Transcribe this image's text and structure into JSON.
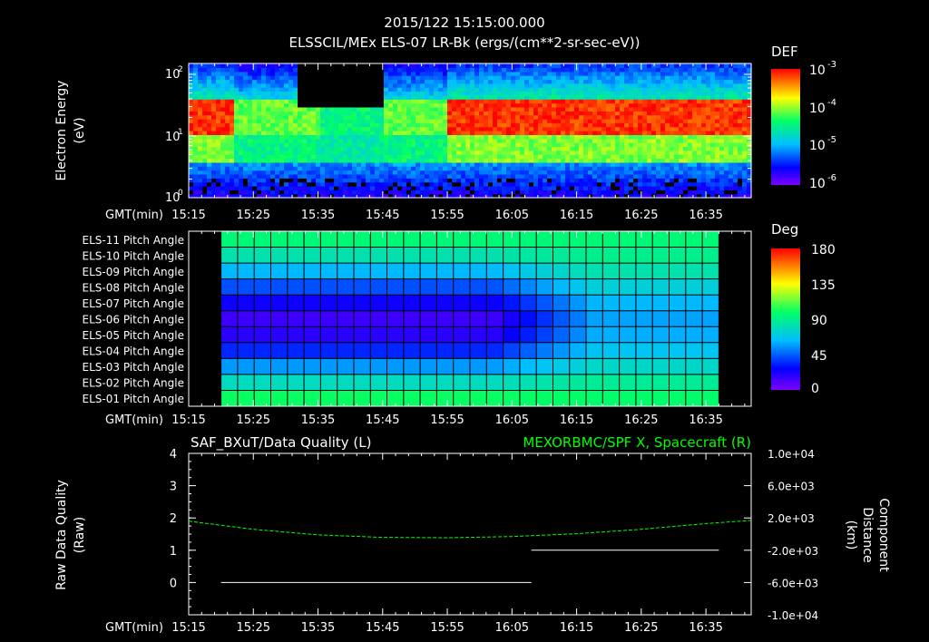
{
  "header": {
    "timestamp": "2015/122 15:15:00.000",
    "title": "ELSSCIL/MEx ELS-07 LR-Bk   (ergs/(cm**2-sr-sec-eV))"
  },
  "time_axis": {
    "label": "GMT(min)",
    "ticks": [
      "15:15",
      "15:25",
      "15:35",
      "15:45",
      "15:55",
      "16:05",
      "16:15",
      "16:25",
      "16:35"
    ]
  },
  "colors": {
    "background": "#000000",
    "axes": "#ffffff",
    "component_trace": "#00ff00",
    "quality_trace": "#ffffff"
  },
  "chart_data": [
    {
      "type": "heatmap",
      "title": "ELSSCIL/MEx ELS-07 LR-Bk   (ergs/(cm**2-sr-sec-eV))",
      "ylabel_line1": "Electron Energy",
      "ylabel_line2": "(eV)",
      "y_scale": "log",
      "ylim": [
        1,
        150
      ],
      "y_ticks": [
        {
          "base": "10",
          "exp": "2"
        },
        {
          "base": "10",
          "exp": "1"
        },
        {
          "base": "10",
          "exp": "0"
        }
      ],
      "colorbar": {
        "label": "DEF",
        "scale": "log",
        "ticks": [
          {
            "base": "10",
            "exp": "-3"
          },
          {
            "base": "10",
            "exp": "-4"
          },
          {
            "base": "10",
            "exp": "-5"
          },
          {
            "base": "10",
            "exp": "-6"
          }
        ]
      },
      "time_start": "15:15",
      "time_end": "16:42",
      "features": [
        {
          "desc": "intense band 10-40 eV",
          "time_range": [
            "15:15",
            "15:22"
          ]
        },
        {
          "desc": "depleted region (data gap) above 30 eV",
          "time_range": [
            "15:35",
            "15:45"
          ]
        },
        {
          "desc": "intense band 10-40 eV",
          "time_range": [
            "15:55",
            "16:42"
          ]
        }
      ]
    },
    {
      "type": "heatmap",
      "colorbar": {
        "label": "Deg",
        "ticks": [
          "180",
          "135",
          "90",
          "45",
          "0"
        ],
        "range": [
          0,
          180
        ]
      },
      "rows": [
        "ELS-11 Pitch Angle",
        "ELS-10 Pitch Angle",
        "ELS-09 Pitch Angle",
        "ELS-08 Pitch Angle",
        "ELS-07 Pitch Angle",
        "ELS-06 Pitch Angle",
        "ELS-05 Pitch Angle",
        "ELS-04 Pitch Angle",
        "ELS-03 Pitch Angle",
        "ELS-02 Pitch Angle",
        "ELS-01 Pitch Angle"
      ],
      "time_start": "15:20",
      "time_end": "16:37",
      "columns": 30,
      "row_baseline_deg": [
        95,
        82,
        62,
        42,
        24,
        14,
        18,
        34,
        56,
        78,
        100
      ],
      "late_period_deg": [
        95,
        90,
        82,
        72,
        62,
        58,
        60,
        66,
        76,
        88,
        98
      ],
      "transition_time": "16:10"
    },
    {
      "type": "line",
      "title_left": "SAF_BXuT/Data Quality (L)",
      "title_right": "MEXORBMC/SPF X, Spacecraft (R)",
      "ylabel_left_line1": "Raw Data Quality",
      "ylabel_left_line2": "(Raw)",
      "ylabel_right_line1": "Component",
      "ylabel_right_line2": "Distance",
      "ylabel_right_line3": "(km)",
      "ylim_left": [
        -1,
        4
      ],
      "y_ticks_left": [
        "4",
        "3",
        "2",
        "1",
        "0"
      ],
      "ylim_right": [
        -10000,
        10000
      ],
      "y_ticks_right": [
        "1.0e+04",
        "6.0e+03",
        "2.0e+03",
        "-2.0e+03",
        "-6.0e+03",
        "-1.0e+04"
      ],
      "series": [
        {
          "name": "SAF_BXuT/Data Quality",
          "axis": "left",
          "segments": [
            {
              "t_start": "15:20",
              "t_end": "16:08",
              "value": 0
            },
            {
              "t_start": "16:08",
              "t_end": "16:37",
              "value": 1
            }
          ]
        },
        {
          "name": "MEXORBMC/SPF X, Spacecraft",
          "axis": "right",
          "style": "dashed",
          "points": [
            {
              "t": "15:15",
              "km": 1600
            },
            {
              "t": "15:25",
              "km": 600
            },
            {
              "t": "15:35",
              "km": -100
            },
            {
              "t": "15:45",
              "km": -400
            },
            {
              "t": "15:55",
              "km": -450
            },
            {
              "t": "16:05",
              "km": -300
            },
            {
              "t": "16:15",
              "km": 50
            },
            {
              "t": "16:25",
              "km": 600
            },
            {
              "t": "16:35",
              "km": 1300
            },
            {
              "t": "16:42",
              "km": 1700
            }
          ]
        }
      ]
    }
  ]
}
